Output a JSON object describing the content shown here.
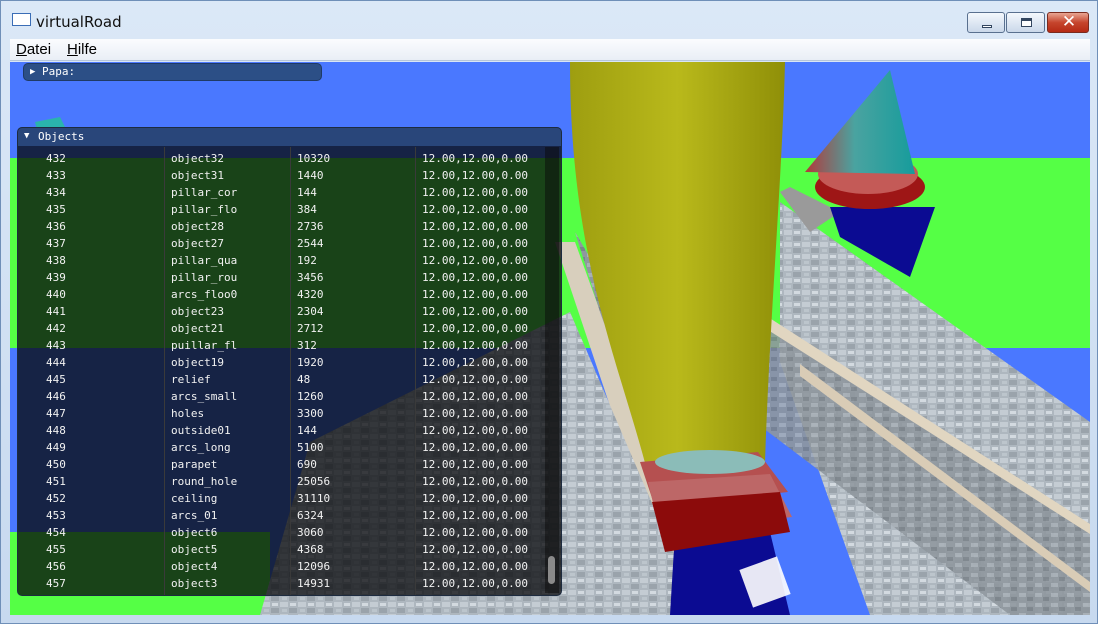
{
  "window": {
    "title": "virtualRoad"
  },
  "menu": {
    "items": [
      {
        "hotkey": "D",
        "rest": "atei"
      },
      {
        "hotkey": "H",
        "rest": "ilfe"
      }
    ]
  },
  "panels": {
    "papa_label": "Papa:",
    "objects_label": "Objects"
  },
  "colors": {
    "sky": "#4a78ff",
    "grass": "#55ff45",
    "panel_header": "#29467a"
  },
  "icons": {
    "collapsed": "triangle-right-icon",
    "expanded": "triangle-down-icon"
  },
  "objects": {
    "rows": [
      [
        "432",
        "object32",
        "10320",
        "12.00,12.00,0.00"
      ],
      [
        "433",
        "object31",
        "1440",
        "12.00,12.00,0.00"
      ],
      [
        "434",
        "pillar_cor",
        "144",
        "12.00,12.00,0.00"
      ],
      [
        "435",
        "pillar_flo",
        "384",
        "12.00,12.00,0.00"
      ],
      [
        "436",
        "object28",
        "2736",
        "12.00,12.00,0.00"
      ],
      [
        "437",
        "object27",
        "2544",
        "12.00,12.00,0.00"
      ],
      [
        "438",
        "pillar_qua",
        "192",
        "12.00,12.00,0.00"
      ],
      [
        "439",
        "pillar_rou",
        "3456",
        "12.00,12.00,0.00"
      ],
      [
        "440",
        "arcs_floo0",
        "4320",
        "12.00,12.00,0.00"
      ],
      [
        "441",
        "object23",
        "2304",
        "12.00,12.00,0.00"
      ],
      [
        "442",
        "object21",
        "2712",
        "12.00,12.00,0.00"
      ],
      [
        "443",
        "puillar_fl",
        "312",
        "12.00,12.00,0.00"
      ],
      [
        "444",
        "object19",
        "1920",
        "12.00,12.00,0.00"
      ],
      [
        "445",
        "relief",
        "48",
        "12.00,12.00,0.00"
      ],
      [
        "446",
        "arcs_small",
        "1260",
        "12.00,12.00,0.00"
      ],
      [
        "447",
        "holes",
        "3300",
        "12.00,12.00,0.00"
      ],
      [
        "448",
        "outside01",
        "144",
        "12.00,12.00,0.00"
      ],
      [
        "449",
        "arcs_long",
        "5100",
        "12.00,12.00,0.00"
      ],
      [
        "450",
        "parapet",
        "690",
        "12.00,12.00,0.00"
      ],
      [
        "451",
        "round_hole",
        "25056",
        "12.00,12.00,0.00"
      ],
      [
        "452",
        "ceiling",
        "31110",
        "12.00,12.00,0.00"
      ],
      [
        "453",
        "arcs_01",
        "6324",
        "12.00,12.00,0.00"
      ],
      [
        "454",
        "object6",
        "3060",
        "12.00,12.00,0.00"
      ],
      [
        "455",
        "object5",
        "4368",
        "12.00,12.00,0.00"
      ],
      [
        "456",
        "object4",
        "12096",
        "12.00,12.00,0.00"
      ],
      [
        "457",
        "object3",
        "14931",
        "12.00,12.00,0.00"
      ]
    ]
  }
}
